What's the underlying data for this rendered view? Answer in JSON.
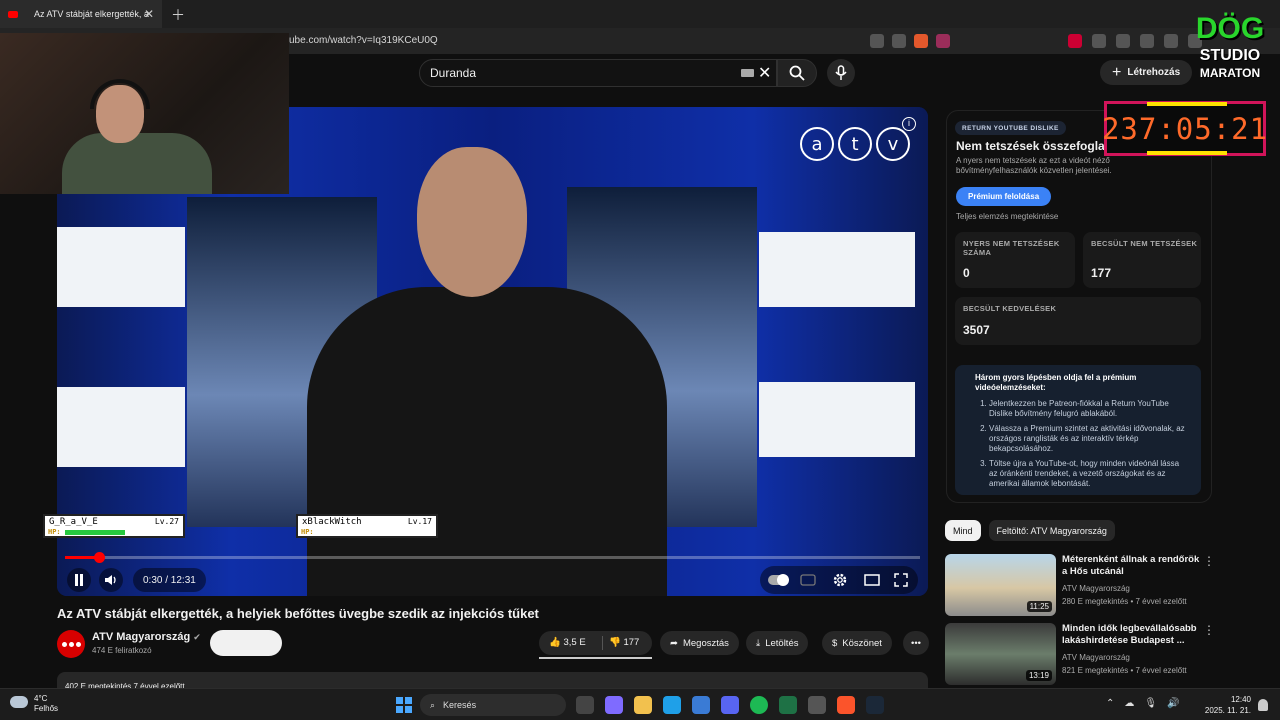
{
  "browser": {
    "tab_title": "Az ATV stábját elkergették, a",
    "url": "ube.com/watch?v=Iq319KCeU0Q"
  },
  "masthead": {
    "search_value": "Duranda",
    "create_label": "Létrehozás"
  },
  "video": {
    "time": "0:30 / 12:31",
    "progress_fraction": 0.04,
    "title": "Az ATV stábját elkergették, a helyiek befőttes üvegbe szedik az injekciós tűket",
    "logo_letters": [
      "a",
      "t",
      "v"
    ]
  },
  "overlay": {
    "player1": {
      "name": "G_R_a_V_E",
      "level": "Lv.27",
      "hp_label": "HP:"
    },
    "player2": {
      "name": "xBlackWitch",
      "level": "Lv.17",
      "hp_label": "HP:"
    },
    "timer": "237:05:21",
    "brand_line1": "DÖG",
    "brand_line2": "STUDIO",
    "brand_line3": "MARATON"
  },
  "channel": {
    "name": "ATV Magyarország",
    "subs": "474 E feliratkozó"
  },
  "actions": {
    "likes": "3,5 E",
    "dislikes": "177",
    "share": "Megosztás",
    "download": "Letöltés",
    "thanks": "Köszönet"
  },
  "description": {
    "stats": "402 E megtekintés  7 évvel ezelőtt"
  },
  "ryd": {
    "badge": "RETURN YOUTUBE DISLIKE",
    "heading": "Nem tetszések összefoglalója",
    "subtitle": "A nyers nem tetszések az ezt a videót néző bővítményfelhasználók közvetlen jelentései.",
    "premium_button": "Prémium feloldása",
    "full_analysis": "Teljes elemzés megtekintése",
    "raw_dislikes_label": "NYERS NEM TETSZÉSEK SZÁMA",
    "raw_dislikes_value": "0",
    "est_dislikes_label": "BECSÜLT NEM TETSZÉSEK",
    "est_dislikes_value": "177",
    "est_likes_label": "BECSÜLT KEDVELÉSEK",
    "est_likes_value": "3507",
    "steps_title": "Három gyors lépésben oldja fel a prémium videóelemzéseket:",
    "steps": [
      "Jelentkezzen be Patreon-fiókkal a Return YouTube Dislike bővítmény felugró ablakából.",
      "Válassza a Premium szintet az aktivitási idővonalak, az országos ranglisták és az interaktív térkép bekapcsolásához.",
      "Töltse újra a YouTube-ot, hogy minden videónál lássa az óránkénti trendeket, a vezető országokat és az amerikai államok lebontását."
    ]
  },
  "recommendations": {
    "chips": [
      "Mind",
      "Feltöltő: ATV Magyarország"
    ],
    "items": [
      {
        "title": "Méterenként állnak a rendőrök a Hős utcánál",
        "channel": "ATV Magyarország",
        "meta": "280 E megtekintés • 7 évvel ezelőtt",
        "duration": "11:25"
      },
      {
        "title": "Minden idők legbevállalósabb lakáshirdetése Budapest ...",
        "channel": "ATV Magyarország",
        "meta": "821 E megtekintés • 7 évvel ezelőtt",
        "duration": "13:19"
      }
    ]
  },
  "taskbar": {
    "temp": "4°C",
    "weather": "Felhős",
    "search": "Keresés",
    "time": "12:40",
    "date": "2025. 11. 21."
  }
}
